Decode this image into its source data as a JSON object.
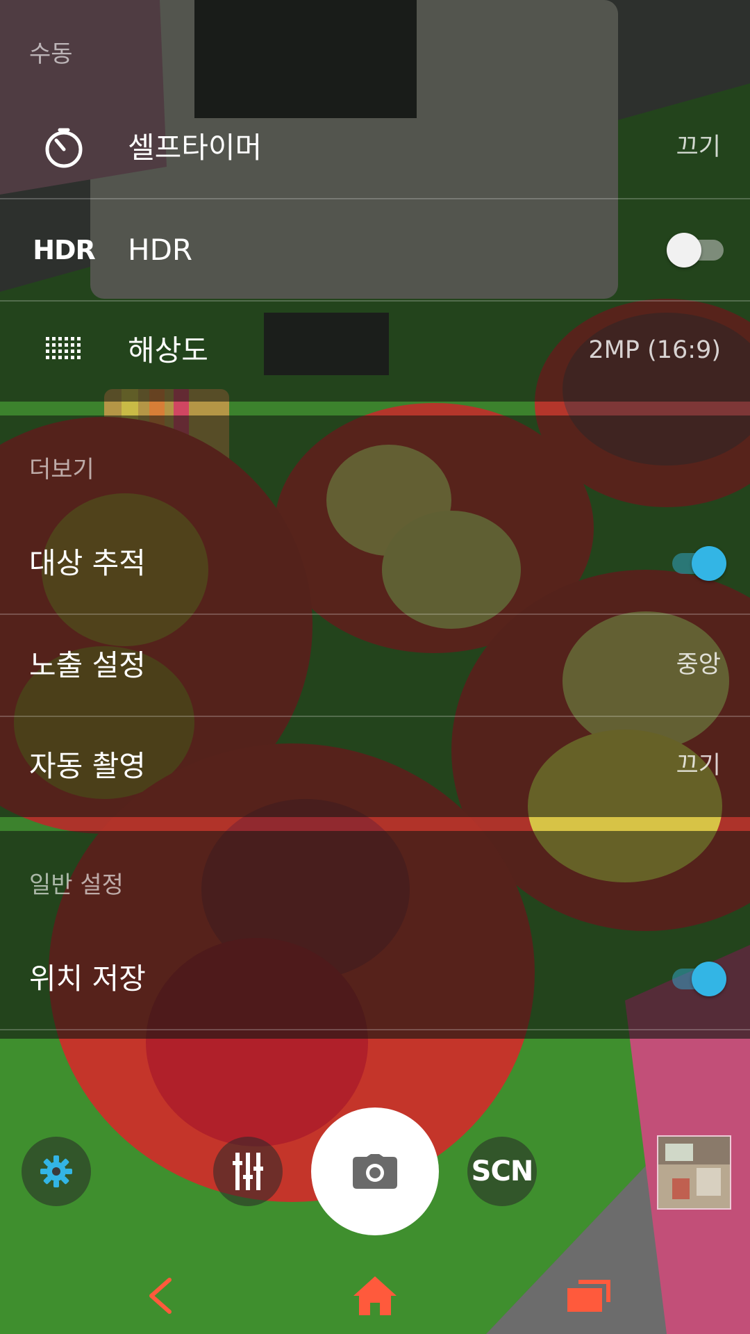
{
  "settings": {
    "manual_header": "수동",
    "self_timer": {
      "icon": "timer-icon",
      "label": "셀프타이머",
      "value": "끄기"
    },
    "hdr": {
      "icon_text": "HDR",
      "label": "HDR",
      "enabled": false
    },
    "resolution": {
      "icon": "resolution-grid-icon",
      "label": "해상도",
      "value": "2MP (16:9)"
    },
    "more_header": "더보기",
    "object_tracking": {
      "label": "대상 추적",
      "enabled": true
    },
    "exposure": {
      "label": "노출 설정",
      "value": "중앙"
    },
    "auto_capture": {
      "label": "자동 촬영",
      "value": "끄기"
    },
    "general_header": "일반 설정",
    "save_location": {
      "label": "위치 저장",
      "enabled": true
    }
  },
  "controls": {
    "settings_icon": "gear-icon",
    "adjust_icon": "sliders-icon",
    "shutter_icon": "camera-icon",
    "scene_label": "SCN",
    "gallery_icon": "thumbnail-preview"
  },
  "navbar": {
    "back_icon": "back-chevron-icon",
    "home_icon": "home-icon",
    "recents_icon": "recents-icon"
  },
  "colors": {
    "accent": "#33b5e5",
    "nav": "#ff5a3c"
  }
}
